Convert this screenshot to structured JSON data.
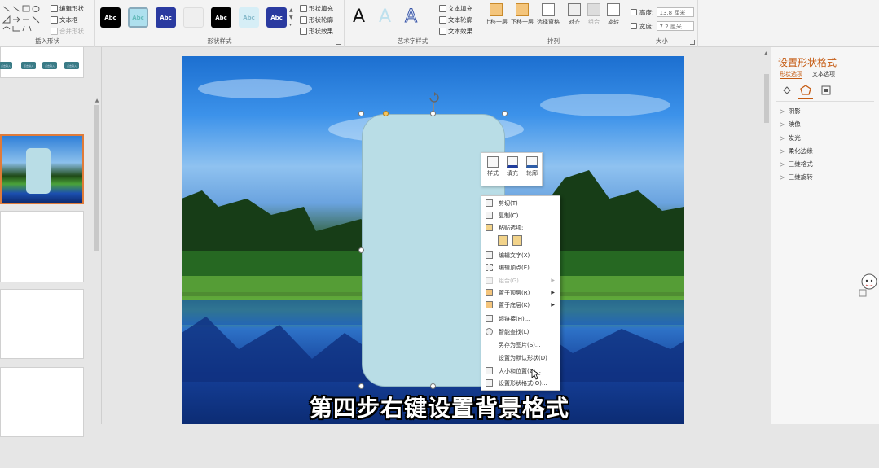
{
  "ribbon": {
    "insert_shapes": {
      "label": "插入形状",
      "edit_shape": "编辑形状",
      "text_box": "文本框",
      "merge_shapes": "合并形状"
    },
    "shape_styles": {
      "label": "形状样式",
      "style_text": "Abc",
      "fill": "形状填充",
      "outline": "形状轮廓",
      "effects": "形状效果"
    },
    "wordart": {
      "label": "艺术字样式",
      "letter": "A",
      "text_fill": "文本填充",
      "text_outline": "文本轮廓",
      "text_effects": "文本效果"
    },
    "arrange": {
      "label": "排列",
      "bring_forward": "上移一层",
      "send_backward": "下移一层",
      "selection_pane": "选择窗格",
      "align": "对齐",
      "group": "组合",
      "rotate": "旋转"
    },
    "size": {
      "label": "大小",
      "height_label": "高度:",
      "height_value": "13.8 厘米",
      "width_label": "宽度:",
      "width_value": "7.2 厘米"
    }
  },
  "mini_toolbar": {
    "style": "样式",
    "fill": "填充",
    "outline": "轮廓"
  },
  "context_menu": {
    "cut": "剪切(T)",
    "copy": "复制(C)",
    "paste_options": "粘贴选项:",
    "edit_text": "编辑文字(X)",
    "edit_points": "编辑顶点(E)",
    "group": "组合(G)",
    "bring_to_front": "置于顶层(R)",
    "send_to_back": "置于底层(K)",
    "hyperlink": "超链接(H)...",
    "smart_lookup": "智能查找(L)",
    "save_as_picture": "另存为图片(S)...",
    "set_default_shape": "设置为默认形状(D)",
    "size_position": "大小和位置(Z)...",
    "format_shape": "设置形状格式(O)..."
  },
  "format_pane": {
    "title": "设置形状格式",
    "tab_shape": "形状选项",
    "tab_text": "文本选项",
    "sections": [
      "阴影",
      "映像",
      "发光",
      "柔化边缘",
      "三维格式",
      "三维旋转"
    ]
  },
  "thumbnail_button_text": "点击输入",
  "caption": "第四步右键设置背景格式",
  "colors": {
    "accent": "#c55a11",
    "shape_fill": "#b9dde6",
    "ribbon_bg": "#f3f3f3"
  }
}
